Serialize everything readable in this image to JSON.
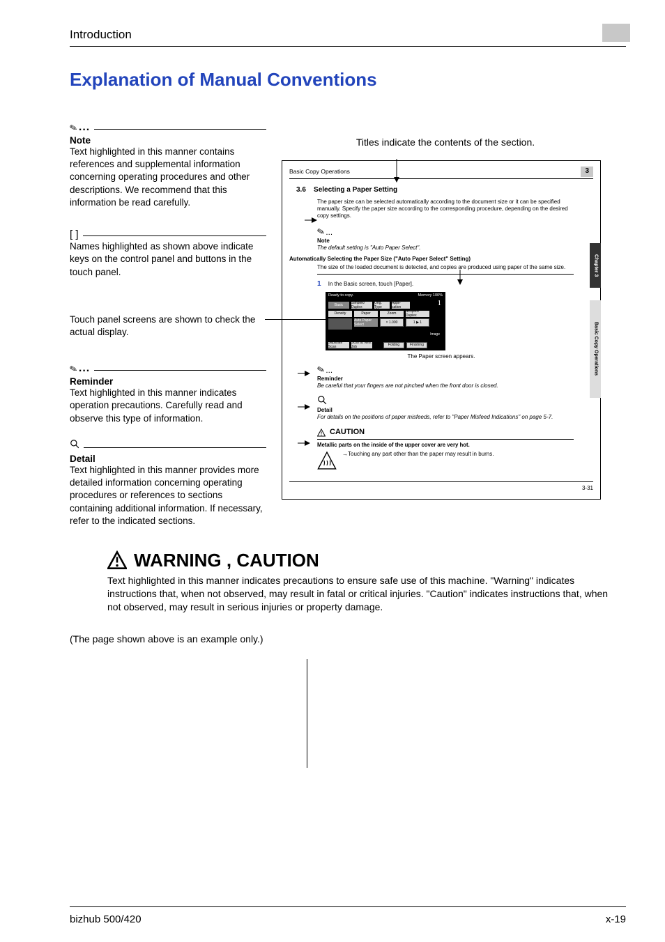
{
  "header": {
    "section": "Introduction"
  },
  "title": "Explanation of Manual Conventions",
  "left": {
    "note": {
      "head": "Note",
      "body": "Text highlighted in this manner contains references and supplemental information concerning operating procedures and other descriptions. We recommend that this information be read carefully."
    },
    "keys": {
      "symbol": "[   ]",
      "body": "Names highlighted as shown above indicate keys on the control panel and buttons in the touch panel."
    },
    "touch": {
      "body": "Touch panel screens are shown to check the actual display."
    },
    "reminder": {
      "head": "Reminder",
      "body": "Text highlighted in this manner indicates operation precautions. Carefully read and observe this type of information."
    },
    "detail": {
      "head": "Detail",
      "body": "Text highlighted in this manner provides more detailed information concerning operating procedures or references to sections containing additional information. If necessary, refer to the indicated sections."
    }
  },
  "right": {
    "caption": "Titles indicate the contents of the section.",
    "doc": {
      "hdr_left": "Basic Copy Operations",
      "hdr_num": "3",
      "sec_no": "3.6",
      "sec_title": "Selecting a Paper Setting",
      "intro": "The paper size can be selected automatically according to the document size or it can be specified manually. Specify the paper size according to the corresponding procedure, depending on the desired copy settings.",
      "note_head": "Note",
      "note_body": "The default setting is \"Auto Paper Select\".",
      "auto_head": "Automatically Selecting the Paper Size (\"Auto Paper Select\" Setting)",
      "auto_body": "The size of the loaded document is detected, and copies are produced using paper of the same size.",
      "step1_no": "1",
      "step1": "In the Basic screen, touch [Paper].",
      "screen_caption": "The Paper screen appears.",
      "reminder_head": "Reminder",
      "reminder_body": "Be careful that your fingers are not pinched when the front door is closed.",
      "detail_head": "Detail",
      "detail_body": "For details on the positions of paper misfeeds, refer to \"Paper Misfeed Indications\" on page 5-7.",
      "caution_title": "CAUTION",
      "caution_bold": "Metallic parts on the inside of the upper cover are very hot.",
      "caution_body": "Touching any part other than the paper may result in burns.",
      "sidetab1": "Chapter 3",
      "sidetab2": "Basic Copy Operations",
      "pg": "3-31",
      "sb": {
        "ready": "Ready to copy.",
        "memory": "Memory",
        "mem100": "100%",
        "one": "1",
        "basic": "Basic",
        "simplex": "Simplex/\nDuplex",
        "orig": "Orig.\nType",
        "appli": "Appli-\ncation",
        "density": "Density",
        "paper": "Paper",
        "zoom": "Zoom",
        "simplex2": "Simplex/\nDuplex",
        "auto": "Auto Paper\nSelect",
        "x1": "× 1.000",
        "oneone": "1 ▶ 1",
        "image": "Image",
        "separate": "Separate\nScan",
        "scan": "Scan at\nNext Job",
        "folding": "Folding",
        "finish": "Finishing"
      }
    }
  },
  "warn": {
    "title": "WARNING , CAUTION",
    "body": "Text highlighted in this manner indicates precautions to ensure safe use of this machine. \"Warning\" indicates instructions that, when not observed, may result in fatal or critical injuries. \"Caution\" indicates instructions that, when not observed, may result in serious injuries or property damage."
  },
  "example_note": "(The page shown above is an example only.)",
  "footer": {
    "model": "bizhub 500/420",
    "page": "x-19"
  }
}
